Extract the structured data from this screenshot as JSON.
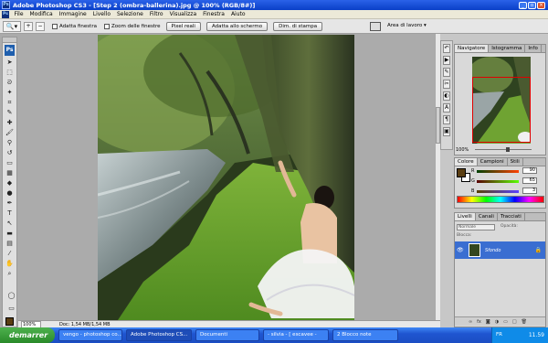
{
  "window": {
    "title": "Adobe Photoshop CS3 - [Step 2 (ombra-ballerina).jpg @ 100% (RGB/8#)]"
  },
  "menu": [
    "File",
    "Modifica",
    "Immagine",
    "Livello",
    "Selezione",
    "Filtro",
    "Visualizza",
    "Finestra",
    "Aiuto"
  ],
  "options": {
    "tool_icon": "zoom-icon",
    "adatta_finestra": "Adatta finestra",
    "zoom_finestre": "Zoom delle finestre",
    "pixel_reali": "Pixel reali",
    "adatta_schermo": "Adatta allo schermo",
    "dim_stampa": "Dim. di stampa",
    "workspace": "Area di lavoro ▾"
  },
  "status": {
    "zoom": "100%",
    "doc": "Doc: 1,54 MB/1,54 MB"
  },
  "navigator": {
    "tabs": [
      "Navigatore",
      "Istogramma",
      "Info"
    ],
    "zoom": "100%"
  },
  "color": {
    "tabs": [
      "Colore",
      "Campioni",
      "Stili"
    ],
    "r_label": "R",
    "g_label": "G",
    "b_label": "B",
    "r": "90",
    "g": "65",
    "b": "3",
    "fg_color": "#5a3e12"
  },
  "layers": {
    "tabs": [
      "Livelli",
      "Canali",
      "Tracciati"
    ],
    "blend": "Normale",
    "opacity": "Opacità:",
    "lock": "Blocca:",
    "layer_name": "Sfondo"
  },
  "taskbar": {
    "start": "demarrer",
    "tasks": [
      "vengo - photoshop co...",
      "Adobe Photoshop CS...",
      "Documenti",
      "- silvia - [ escavee -",
      "2 Blocco note"
    ],
    "lang": "FR",
    "clock": "11.59"
  }
}
